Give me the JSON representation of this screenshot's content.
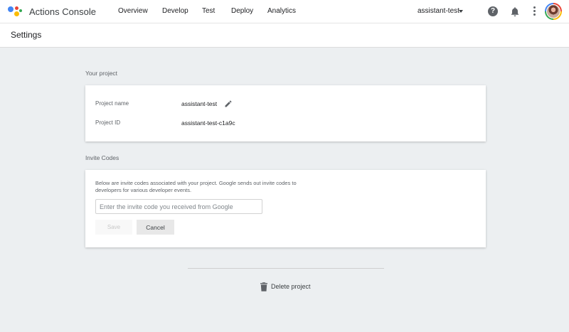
{
  "app": {
    "title": "Actions Console",
    "logo_colors": [
      "#4285f4",
      "#ea4335",
      "#fbbc05",
      "#34a853"
    ]
  },
  "nav": [
    {
      "label": "Overview"
    },
    {
      "label": "Develop"
    },
    {
      "label": "Test"
    },
    {
      "label": "Deploy"
    },
    {
      "label": "Analytics"
    }
  ],
  "project_selector": {
    "label": "assistant-test",
    "icon": "chevron-down-icon"
  },
  "toolbar_icons": [
    "help-icon",
    "bell-icon",
    "more-vert-icon",
    "avatar"
  ],
  "page": {
    "title": "Settings"
  },
  "your_project": {
    "section_label": "Your project",
    "name_label": "Project name",
    "name_value": "assistant-test",
    "id_label": "Project ID",
    "id_value": "assistant-test-c1a9c",
    "edit_icon": "pencil-icon"
  },
  "invite_codes": {
    "section_label": "Invite Codes",
    "description": "Below are invite codes associated with your project. Google sends out invite codes to developers for various developer events.",
    "input_value": "",
    "input_placeholder": "Enter the invite code you received from Google",
    "save_label": "Save",
    "cancel_label": "Cancel"
  },
  "delete": {
    "label": "Delete project",
    "icon": "trash-icon"
  },
  "colors": {
    "background": "#eceff1",
    "card": "#ffffff",
    "text": "#202124",
    "muted": "#5f6368"
  }
}
